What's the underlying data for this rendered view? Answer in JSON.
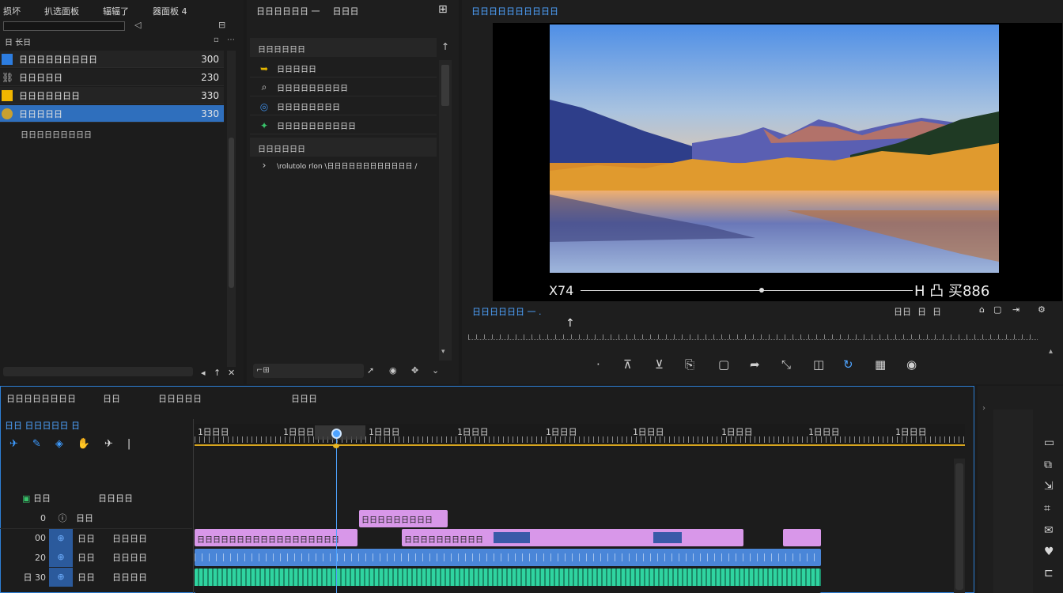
{
  "project_panel": {
    "menu": [
      "损坏",
      "扒选面板",
      "辐辐了",
      "器面板 4"
    ],
    "header_label": "日 长日",
    "items": [
      {
        "label": "日日日日日日日日日",
        "value": "300",
        "color": "#2d7de0"
      },
      {
        "label": "日日日日日",
        "value": "230",
        "color": "#888888"
      },
      {
        "label": "日日日日日日日",
        "value": "330",
        "color": "#f2b600"
      },
      {
        "label": "日日日日日",
        "value": "330",
        "color": "#c8a030"
      }
    ],
    "extra_label": "日日日日日日日日日"
  },
  "effects_panel": {
    "title": "日日日日日日 一",
    "title2": "日日日",
    "section1": "日日日日日日",
    "items": [
      "日日日日日",
      "日日日日日日日日日",
      "日日日日日日日日",
      "日日日日日日日日日日"
    ],
    "section2": "日日日日日日",
    "long_item": "\\rolutolo rlon \\日日日日日日日日日日日日 /"
  },
  "program_monitor": {
    "title": "日日日日日日日日日日",
    "overlay_left": "X74",
    "overlay_right": "H 凸 买886",
    "label": "日日日日日日 一 .",
    "controls_right": [
      "日日",
      "日",
      "日"
    ]
  },
  "timeline": {
    "tabs": [
      "日日日日日日日日",
      "日日",
      "日日日日日",
      "日日日"
    ],
    "sequence_label": "日日 日日日日日 日",
    "ruler": [
      "1日日日",
      "1日日日",
      "1日日日",
      "1日日日",
      "1日日日",
      "1日日日",
      "1日日日",
      "1日日日",
      "1日日日"
    ],
    "track_header": [
      "日日",
      "日日日日"
    ],
    "tracks": [
      {
        "num": "0",
        "a": "日日",
        "b": ""
      },
      {
        "num": "00",
        "a": "日日",
        "b": "日日日日"
      },
      {
        "num": "20",
        "a": "日日",
        "b": "日日日日"
      },
      {
        "num": "日 30",
        "a": "日日",
        "b": "日日日日"
      }
    ],
    "clip_titles": [
      "日日日日日日日日日",
      "日日日日日日日日日日日日日日日日日日",
      "日日日日日日日日日日日日日日"
    ],
    "colors": {
      "pink": "#d897e9",
      "blue": "#4a86d8",
      "green": "#2fd4a0",
      "accent": "#2d8cf0"
    }
  }
}
